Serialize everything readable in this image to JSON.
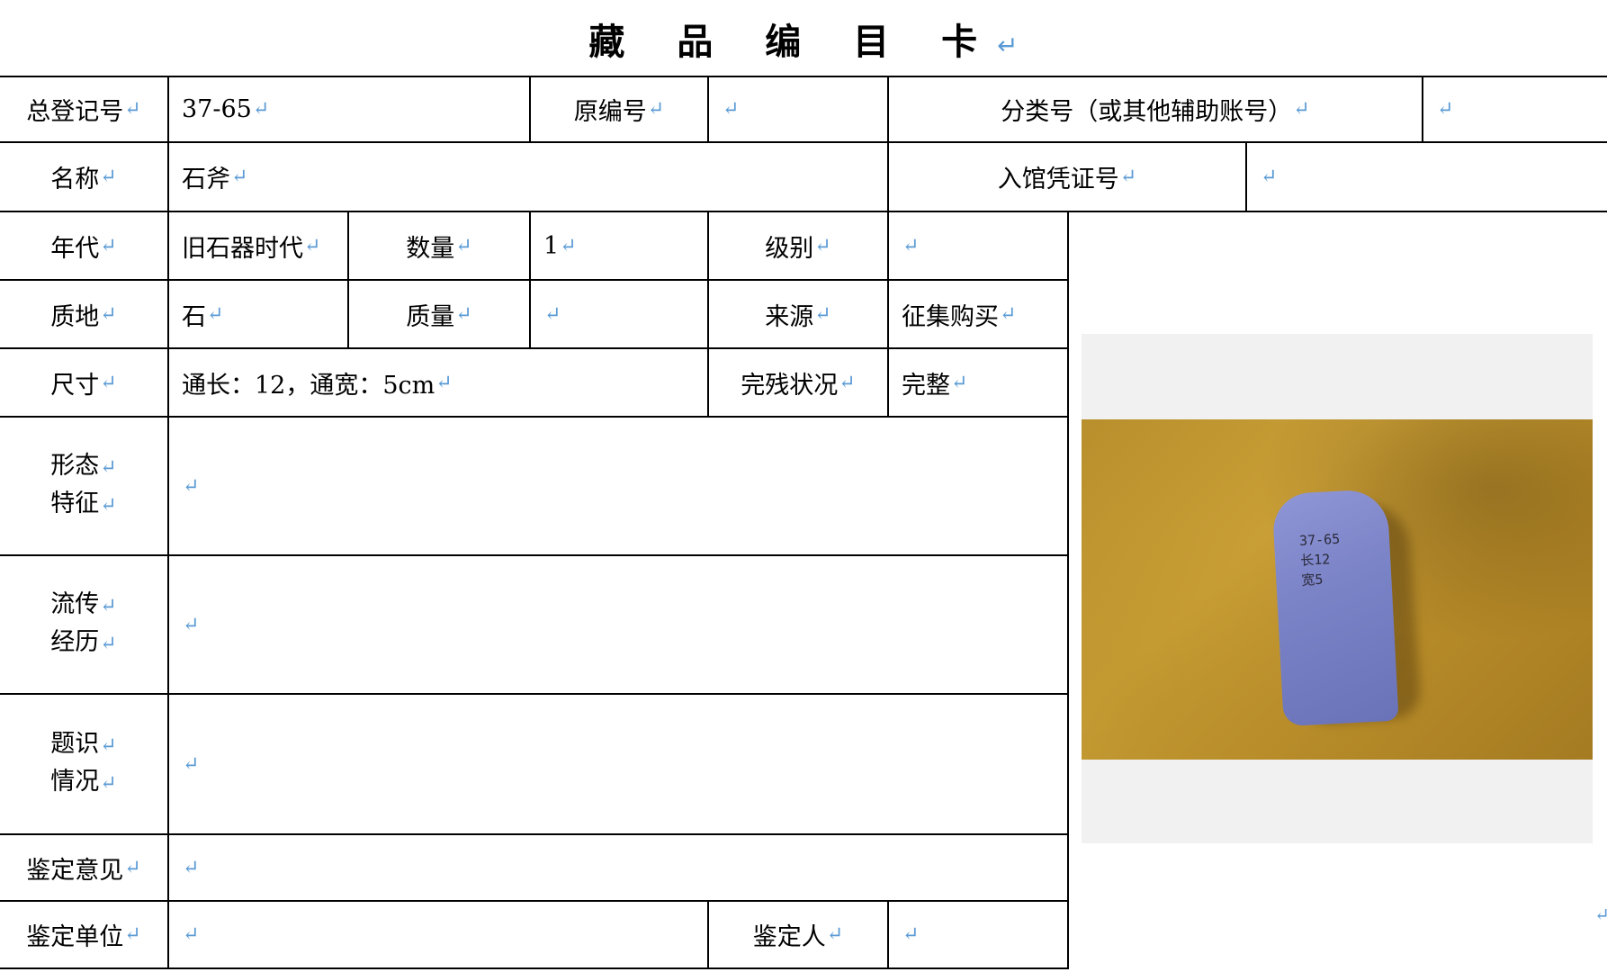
{
  "title": "藏 品 编 目 卡",
  "return_mark": "↵",
  "fields": {
    "reg_no_label": "总登记号",
    "reg_no_value": "37-65",
    "orig_no_label": "原编号",
    "orig_no_value": "",
    "class_no_label": "分类号（或其他辅助账号）",
    "class_no_value": "",
    "name_label": "名称",
    "name_value": "石斧",
    "voucher_label": "入馆凭证号",
    "voucher_value": "",
    "era_label": "年代",
    "era_value": "旧石器时代",
    "qty_label": "数量",
    "qty_value": "1",
    "grade_label": "级别",
    "grade_value": "",
    "material_label": "质地",
    "material_value": "石",
    "mass_label": "质量",
    "mass_value": "",
    "source_label": "来源",
    "source_value": "征集购买",
    "size_label": "尺寸",
    "size_value": "通长：12，通宽：5cm",
    "condition_label": "完残状况",
    "condition_value": "完整",
    "form_label_1": "形态",
    "form_label_2": "特征",
    "form_value": "",
    "history_label_1": "流传",
    "history_label_2": "经历",
    "history_value": "",
    "inscription_label_1": "题识",
    "inscription_label_2": "情况",
    "inscription_value": "",
    "opinion_label": "鉴定意见",
    "opinion_value": "",
    "unit_label": "鉴定单位",
    "unit_value": "",
    "appraiser_label": "鉴定人",
    "appraiser_value": ""
  },
  "photo": {
    "stone_marking_1": "37-65",
    "stone_marking_2": "长12",
    "stone_marking_3": "宽5"
  }
}
